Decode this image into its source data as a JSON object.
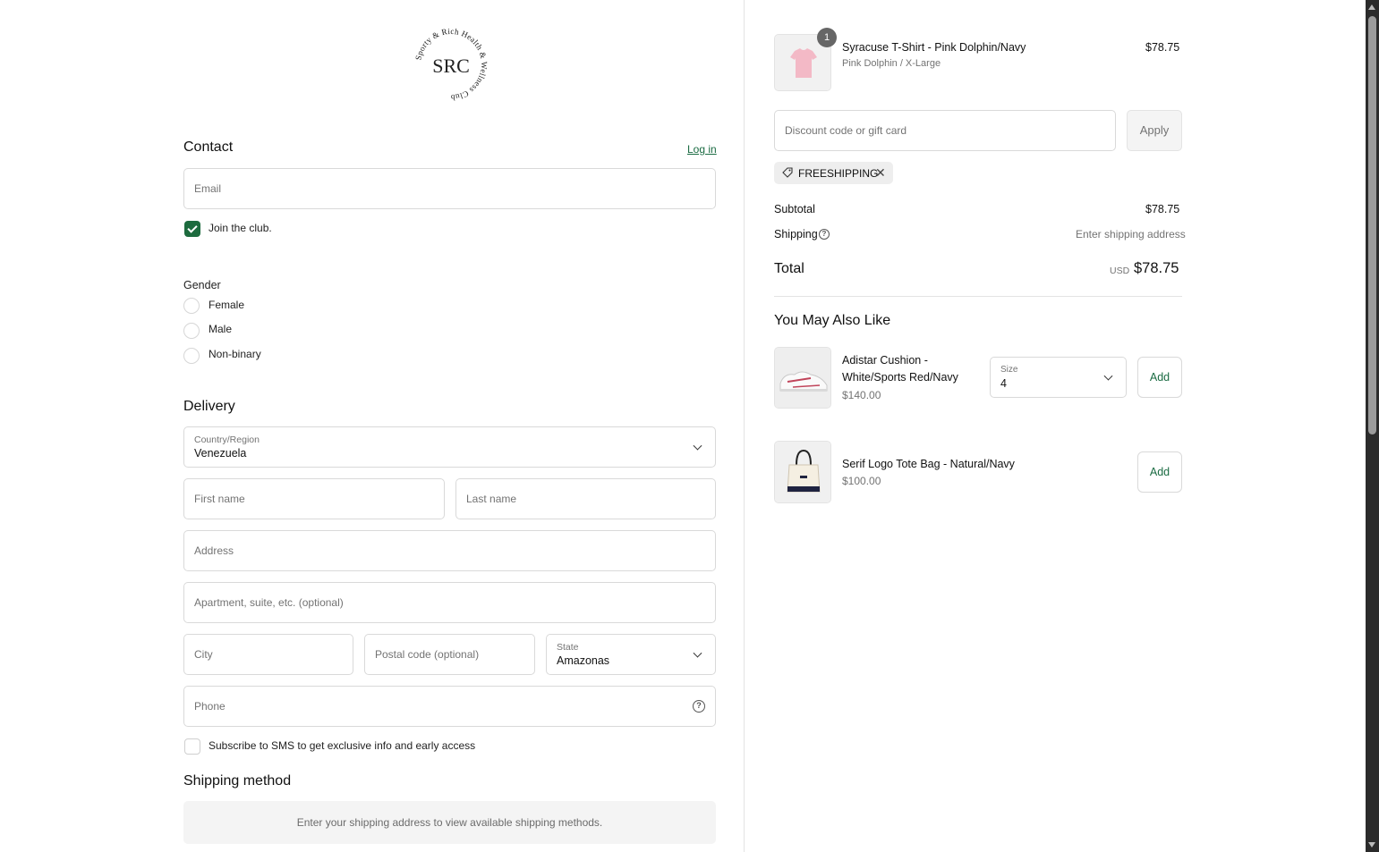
{
  "brand": {
    "logo_ring_text": "Sporty & Rich Health & Wellness Club",
    "logo_monogram": "SRC"
  },
  "contact": {
    "title": "Contact",
    "login_link": "Log in",
    "email_placeholder": "Email",
    "join_club_label": "Join the club.",
    "join_club_checked": true
  },
  "gender": {
    "title": "Gender",
    "options": [
      "Female",
      "Male",
      "Non-binary"
    ]
  },
  "delivery": {
    "title": "Delivery",
    "country_label": "Country/Region",
    "country_value": "Venezuela",
    "first_name_placeholder": "First name",
    "last_name_placeholder": "Last name",
    "address_placeholder": "Address",
    "apartment_placeholder": "Apartment, suite, etc. (optional)",
    "city_placeholder": "City",
    "postal_placeholder": "Postal code (optional)",
    "state_label": "State",
    "state_value": "Amazonas",
    "phone_placeholder": "Phone",
    "sms_label": "Subscribe to SMS to get exclusive info and early access",
    "sms_checked": false
  },
  "shipping_method": {
    "title": "Shipping method",
    "message": "Enter your shipping address to view available shipping methods."
  },
  "cart": {
    "item": {
      "quantity": "1",
      "title": "Syracuse T-Shirt - Pink Dolphin/Navy",
      "variant": "Pink Dolphin / X-Large",
      "price": "$78.75"
    },
    "discount_placeholder": "Discount code or gift card",
    "apply_label": "Apply",
    "applied_code": "FREESHIPPING",
    "subtotal_label": "Subtotal",
    "subtotal_value": "$78.75",
    "shipping_label": "Shipping",
    "shipping_value": "Enter shipping address",
    "total_label": "Total",
    "total_currency": "USD",
    "total_value": "$78.75"
  },
  "recommendations": {
    "title": "You May Also Like",
    "items": [
      {
        "title_line1": "Adistar Cushion -",
        "title_line2": "White/Sports Red/Navy",
        "price": "$140.00",
        "size_label": "Size",
        "size_value": "4",
        "add_label": "Add"
      },
      {
        "title_line1": "Serif Logo Tote Bag - Natural/Navy",
        "price": "$100.00",
        "add_label": "Add"
      }
    ]
  },
  "colors": {
    "accent": "#1d6b3e",
    "link": "#1a6b42",
    "border": "#d9d9d9",
    "muted_text": "#737373"
  }
}
